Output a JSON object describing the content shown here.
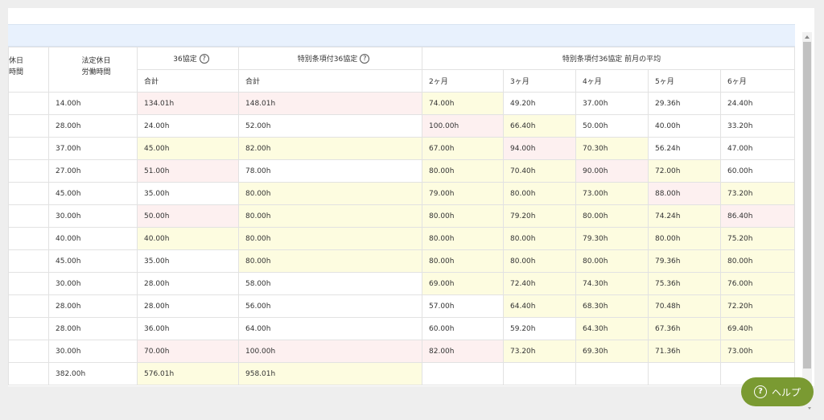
{
  "header": {
    "col0": [
      "休日",
      "時間"
    ],
    "col1": [
      "法定休日",
      "労働時間"
    ],
    "group_36": "36協定",
    "group_special": "特別条項付36協定",
    "group_avg": "特別条項付36協定 前月の平均",
    "sub_total_36": "合計",
    "sub_total_special": "合計",
    "months": [
      "2ヶ月",
      "3ヶ月",
      "4ヶ月",
      "5ヶ月",
      "6ヶ月"
    ]
  },
  "rows": [
    {
      "holiday": "14.00h",
      "c36": {
        "v": "134.01h",
        "s": "p"
      },
      "sp": {
        "v": "148.01h",
        "s": "p"
      },
      "m": [
        {
          "v": "74.00h",
          "s": "y"
        },
        {
          "v": "49.20h",
          "s": "w"
        },
        {
          "v": "37.00h",
          "s": "w"
        },
        {
          "v": "29.36h",
          "s": "w"
        },
        {
          "v": "24.40h",
          "s": "w"
        }
      ]
    },
    {
      "holiday": "28.00h",
      "c36": {
        "v": "24.00h",
        "s": "w"
      },
      "sp": {
        "v": "52.00h",
        "s": "w"
      },
      "m": [
        {
          "v": "100.00h",
          "s": "p"
        },
        {
          "v": "66.40h",
          "s": "y"
        },
        {
          "v": "50.00h",
          "s": "w"
        },
        {
          "v": "40.00h",
          "s": "w"
        },
        {
          "v": "33.20h",
          "s": "w"
        }
      ]
    },
    {
      "holiday": "37.00h",
      "c36": {
        "v": "45.00h",
        "s": "y"
      },
      "sp": {
        "v": "82.00h",
        "s": "y"
      },
      "m": [
        {
          "v": "67.00h",
          "s": "y"
        },
        {
          "v": "94.00h",
          "s": "p"
        },
        {
          "v": "70.30h",
          "s": "y"
        },
        {
          "v": "56.24h",
          "s": "w"
        },
        {
          "v": "47.00h",
          "s": "w"
        }
      ]
    },
    {
      "holiday": "27.00h",
      "c36": {
        "v": "51.00h",
        "s": "p"
      },
      "sp": {
        "v": "78.00h",
        "s": "w"
      },
      "m": [
        {
          "v": "80.00h",
          "s": "y"
        },
        {
          "v": "70.40h",
          "s": "y"
        },
        {
          "v": "90.00h",
          "s": "p"
        },
        {
          "v": "72.00h",
          "s": "y"
        },
        {
          "v": "60.00h",
          "s": "w"
        }
      ]
    },
    {
      "holiday": "45.00h",
      "c36": {
        "v": "35.00h",
        "s": "w"
      },
      "sp": {
        "v": "80.00h",
        "s": "y"
      },
      "m": [
        {
          "v": "79.00h",
          "s": "y"
        },
        {
          "v": "80.00h",
          "s": "y"
        },
        {
          "v": "73.00h",
          "s": "y"
        },
        {
          "v": "88.00h",
          "s": "p"
        },
        {
          "v": "73.20h",
          "s": "y"
        }
      ]
    },
    {
      "holiday": "30.00h",
      "c36": {
        "v": "50.00h",
        "s": "p"
      },
      "sp": {
        "v": "80.00h",
        "s": "y"
      },
      "m": [
        {
          "v": "80.00h",
          "s": "y"
        },
        {
          "v": "79.20h",
          "s": "y"
        },
        {
          "v": "80.00h",
          "s": "y"
        },
        {
          "v": "74.24h",
          "s": "y"
        },
        {
          "v": "86.40h",
          "s": "p"
        }
      ]
    },
    {
      "holiday": "40.00h",
      "c36": {
        "v": "40.00h",
        "s": "y"
      },
      "sp": {
        "v": "80.00h",
        "s": "y"
      },
      "m": [
        {
          "v": "80.00h",
          "s": "y"
        },
        {
          "v": "80.00h",
          "s": "y"
        },
        {
          "v": "79.30h",
          "s": "y"
        },
        {
          "v": "80.00h",
          "s": "y"
        },
        {
          "v": "75.20h",
          "s": "y"
        }
      ]
    },
    {
      "holiday": "45.00h",
      "c36": {
        "v": "35.00h",
        "s": "w"
      },
      "sp": {
        "v": "80.00h",
        "s": "y"
      },
      "m": [
        {
          "v": "80.00h",
          "s": "y"
        },
        {
          "v": "80.00h",
          "s": "y"
        },
        {
          "v": "80.00h",
          "s": "y"
        },
        {
          "v": "79.36h",
          "s": "y"
        },
        {
          "v": "80.00h",
          "s": "y"
        }
      ]
    },
    {
      "holiday": "30.00h",
      "c36": {
        "v": "28.00h",
        "s": "w"
      },
      "sp": {
        "v": "58.00h",
        "s": "w"
      },
      "m": [
        {
          "v": "69.00h",
          "s": "y"
        },
        {
          "v": "72.40h",
          "s": "y"
        },
        {
          "v": "74.30h",
          "s": "y"
        },
        {
          "v": "75.36h",
          "s": "y"
        },
        {
          "v": "76.00h",
          "s": "y"
        }
      ]
    },
    {
      "holiday": "28.00h",
      "c36": {
        "v": "28.00h",
        "s": "w"
      },
      "sp": {
        "v": "56.00h",
        "s": "w"
      },
      "m": [
        {
          "v": "57.00h",
          "s": "w"
        },
        {
          "v": "64.40h",
          "s": "y"
        },
        {
          "v": "68.30h",
          "s": "y"
        },
        {
          "v": "70.48h",
          "s": "y"
        },
        {
          "v": "72.20h",
          "s": "y"
        }
      ]
    },
    {
      "holiday": "28.00h",
      "c36": {
        "v": "36.00h",
        "s": "w"
      },
      "sp": {
        "v": "64.00h",
        "s": "w"
      },
      "m": [
        {
          "v": "60.00h",
          "s": "w"
        },
        {
          "v": "59.20h",
          "s": "w"
        },
        {
          "v": "64.30h",
          "s": "y"
        },
        {
          "v": "67.36h",
          "s": "y"
        },
        {
          "v": "69.40h",
          "s": "y"
        }
      ]
    },
    {
      "holiday": "30.00h",
      "c36": {
        "v": "70.00h",
        "s": "p"
      },
      "sp": {
        "v": "100.00h",
        "s": "p"
      },
      "m": [
        {
          "v": "82.00h",
          "s": "p"
        },
        {
          "v": "73.20h",
          "s": "y"
        },
        {
          "v": "69.30h",
          "s": "y"
        },
        {
          "v": "71.36h",
          "s": "y"
        },
        {
          "v": "73.00h",
          "s": "y"
        }
      ]
    },
    {
      "holiday": "382.00h",
      "c36": {
        "v": "576.01h",
        "s": "y"
      },
      "sp": {
        "v": "958.01h",
        "s": "y"
      },
      "m": [
        {
          "v": "",
          "s": "w"
        },
        {
          "v": "",
          "s": "w"
        },
        {
          "v": "",
          "s": "w"
        },
        {
          "v": "",
          "s": "w"
        },
        {
          "v": "",
          "s": "w"
        }
      ]
    }
  ],
  "help_button": {
    "label": "ヘルプ",
    "icon": "question-circle-icon"
  },
  "colors": {
    "warn_yellow": "#fdfce0",
    "alert_pink": "#fdf0f0",
    "help_green": "#7a9a32",
    "header_blue": "#e8f1fd"
  }
}
